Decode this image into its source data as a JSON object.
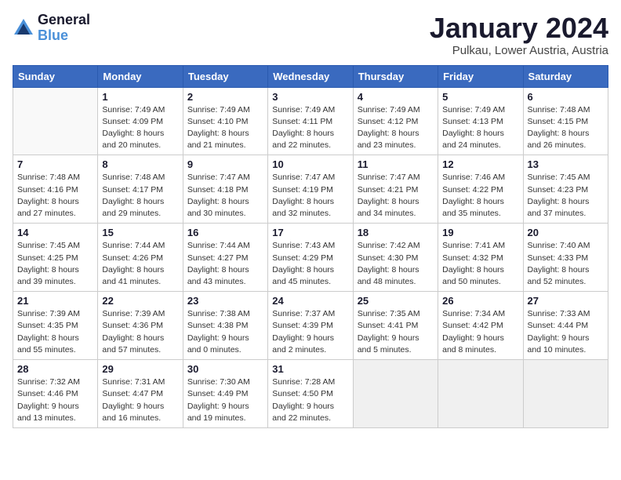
{
  "header": {
    "logo_line1": "General",
    "logo_line2": "Blue",
    "month": "January 2024",
    "location": "Pulkau, Lower Austria, Austria"
  },
  "weekdays": [
    "Sunday",
    "Monday",
    "Tuesday",
    "Wednesday",
    "Thursday",
    "Friday",
    "Saturday"
  ],
  "weeks": [
    [
      {
        "day": "",
        "info": ""
      },
      {
        "day": "1",
        "info": "Sunrise: 7:49 AM\nSunset: 4:09 PM\nDaylight: 8 hours\nand 20 minutes."
      },
      {
        "day": "2",
        "info": "Sunrise: 7:49 AM\nSunset: 4:10 PM\nDaylight: 8 hours\nand 21 minutes."
      },
      {
        "day": "3",
        "info": "Sunrise: 7:49 AM\nSunset: 4:11 PM\nDaylight: 8 hours\nand 22 minutes."
      },
      {
        "day": "4",
        "info": "Sunrise: 7:49 AM\nSunset: 4:12 PM\nDaylight: 8 hours\nand 23 minutes."
      },
      {
        "day": "5",
        "info": "Sunrise: 7:49 AM\nSunset: 4:13 PM\nDaylight: 8 hours\nand 24 minutes."
      },
      {
        "day": "6",
        "info": "Sunrise: 7:48 AM\nSunset: 4:15 PM\nDaylight: 8 hours\nand 26 minutes."
      }
    ],
    [
      {
        "day": "7",
        "info": "Sunrise: 7:48 AM\nSunset: 4:16 PM\nDaylight: 8 hours\nand 27 minutes."
      },
      {
        "day": "8",
        "info": "Sunrise: 7:48 AM\nSunset: 4:17 PM\nDaylight: 8 hours\nand 29 minutes."
      },
      {
        "day": "9",
        "info": "Sunrise: 7:47 AM\nSunset: 4:18 PM\nDaylight: 8 hours\nand 30 minutes."
      },
      {
        "day": "10",
        "info": "Sunrise: 7:47 AM\nSunset: 4:19 PM\nDaylight: 8 hours\nand 32 minutes."
      },
      {
        "day": "11",
        "info": "Sunrise: 7:47 AM\nSunset: 4:21 PM\nDaylight: 8 hours\nand 34 minutes."
      },
      {
        "day": "12",
        "info": "Sunrise: 7:46 AM\nSunset: 4:22 PM\nDaylight: 8 hours\nand 35 minutes."
      },
      {
        "day": "13",
        "info": "Sunrise: 7:45 AM\nSunset: 4:23 PM\nDaylight: 8 hours\nand 37 minutes."
      }
    ],
    [
      {
        "day": "14",
        "info": "Sunrise: 7:45 AM\nSunset: 4:25 PM\nDaylight: 8 hours\nand 39 minutes."
      },
      {
        "day": "15",
        "info": "Sunrise: 7:44 AM\nSunset: 4:26 PM\nDaylight: 8 hours\nand 41 minutes."
      },
      {
        "day": "16",
        "info": "Sunrise: 7:44 AM\nSunset: 4:27 PM\nDaylight: 8 hours\nand 43 minutes."
      },
      {
        "day": "17",
        "info": "Sunrise: 7:43 AM\nSunset: 4:29 PM\nDaylight: 8 hours\nand 45 minutes."
      },
      {
        "day": "18",
        "info": "Sunrise: 7:42 AM\nSunset: 4:30 PM\nDaylight: 8 hours\nand 48 minutes."
      },
      {
        "day": "19",
        "info": "Sunrise: 7:41 AM\nSunset: 4:32 PM\nDaylight: 8 hours\nand 50 minutes."
      },
      {
        "day": "20",
        "info": "Sunrise: 7:40 AM\nSunset: 4:33 PM\nDaylight: 8 hours\nand 52 minutes."
      }
    ],
    [
      {
        "day": "21",
        "info": "Sunrise: 7:39 AM\nSunset: 4:35 PM\nDaylight: 8 hours\nand 55 minutes."
      },
      {
        "day": "22",
        "info": "Sunrise: 7:39 AM\nSunset: 4:36 PM\nDaylight: 8 hours\nand 57 minutes."
      },
      {
        "day": "23",
        "info": "Sunrise: 7:38 AM\nSunset: 4:38 PM\nDaylight: 9 hours\nand 0 minutes."
      },
      {
        "day": "24",
        "info": "Sunrise: 7:37 AM\nSunset: 4:39 PM\nDaylight: 9 hours\nand 2 minutes."
      },
      {
        "day": "25",
        "info": "Sunrise: 7:35 AM\nSunset: 4:41 PM\nDaylight: 9 hours\nand 5 minutes."
      },
      {
        "day": "26",
        "info": "Sunrise: 7:34 AM\nSunset: 4:42 PM\nDaylight: 9 hours\nand 8 minutes."
      },
      {
        "day": "27",
        "info": "Sunrise: 7:33 AM\nSunset: 4:44 PM\nDaylight: 9 hours\nand 10 minutes."
      }
    ],
    [
      {
        "day": "28",
        "info": "Sunrise: 7:32 AM\nSunset: 4:46 PM\nDaylight: 9 hours\nand 13 minutes."
      },
      {
        "day": "29",
        "info": "Sunrise: 7:31 AM\nSunset: 4:47 PM\nDaylight: 9 hours\nand 16 minutes."
      },
      {
        "day": "30",
        "info": "Sunrise: 7:30 AM\nSunset: 4:49 PM\nDaylight: 9 hours\nand 19 minutes."
      },
      {
        "day": "31",
        "info": "Sunrise: 7:28 AM\nSunset: 4:50 PM\nDaylight: 9 hours\nand 22 minutes."
      },
      {
        "day": "",
        "info": ""
      },
      {
        "day": "",
        "info": ""
      },
      {
        "day": "",
        "info": ""
      }
    ]
  ]
}
